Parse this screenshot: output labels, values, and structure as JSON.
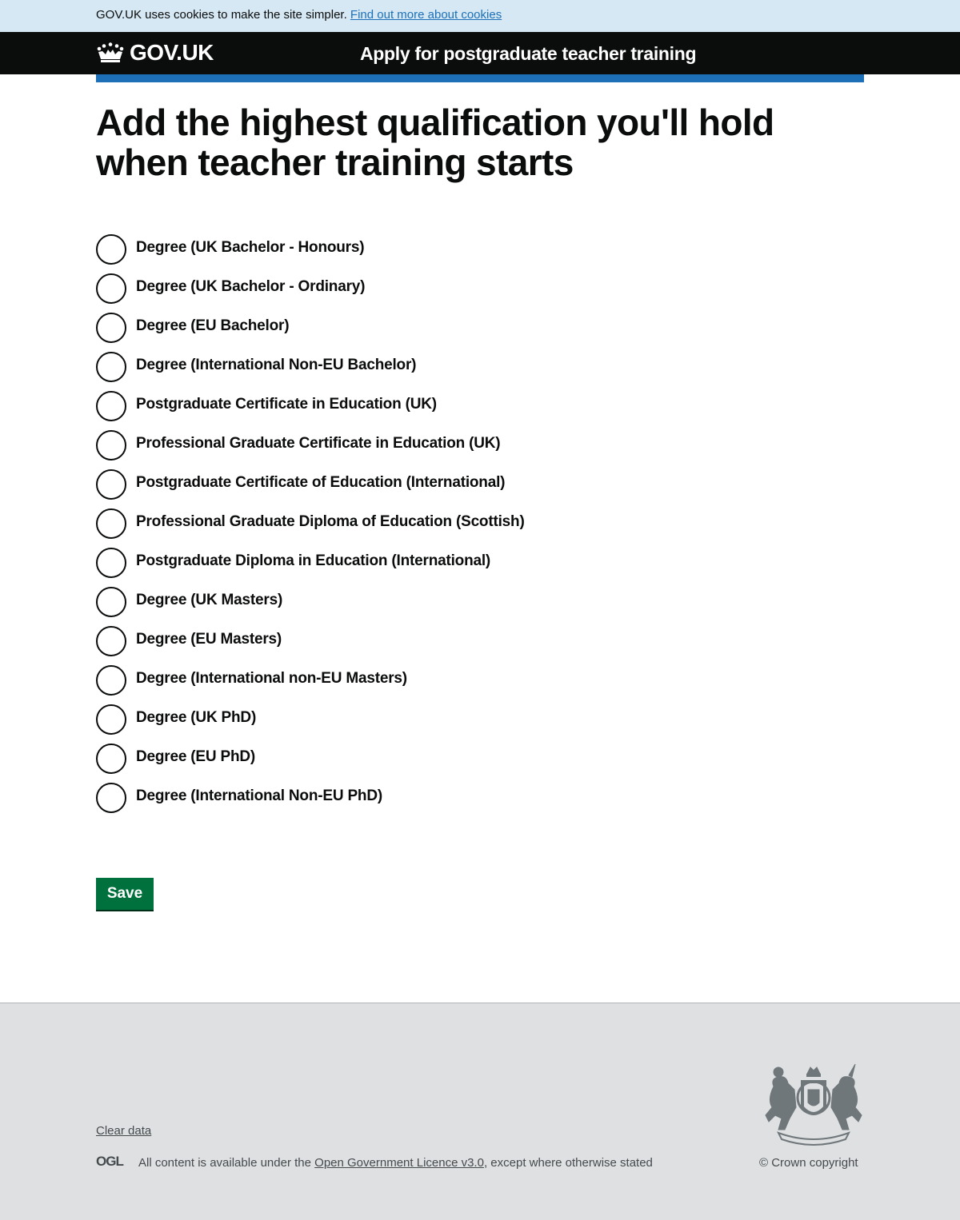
{
  "cookie_banner": {
    "text": "GOV.UK uses cookies to make the site simpler.",
    "link_label": "Find out more about cookies"
  },
  "header": {
    "logo_text": "GOV.UK",
    "service_name": "Apply for postgraduate teacher training"
  },
  "page": {
    "title": "Add the highest qualification you'll hold when teacher training starts"
  },
  "qualifications": [
    {
      "label": "Degree (UK Bachelor - Honours)",
      "selected": false
    },
    {
      "label": "Degree (UK Bachelor - Ordinary)",
      "selected": false
    },
    {
      "label": "Degree (EU Bachelor)",
      "selected": false
    },
    {
      "label": "Degree (International Non-EU Bachelor)",
      "selected": false
    },
    {
      "label": "Postgraduate Certificate in Education (UK)",
      "selected": false
    },
    {
      "label": "Professional Graduate Certificate in Education (UK)",
      "selected": false
    },
    {
      "label": "Postgraduate Certificate of Education (International)",
      "selected": false
    },
    {
      "label": "Professional Graduate Diploma of Education (Scottish)",
      "selected": false
    },
    {
      "label": "Postgraduate Diploma in Education (International)",
      "selected": false
    },
    {
      "label": "Degree (UK Masters)",
      "selected": false
    },
    {
      "label": "Degree (EU Masters)",
      "selected": false
    },
    {
      "label": "Degree (International non-EU Masters)",
      "selected": false
    },
    {
      "label": "Degree (UK PhD)",
      "selected": false
    },
    {
      "label": "Degree (EU PhD)",
      "selected": false
    },
    {
      "label": "Degree (International Non-EU PhD)",
      "selected": false
    }
  ],
  "actions": {
    "save_label": "Save"
  },
  "footer": {
    "clear_data_label": "Clear data",
    "ogl_logo_text": "OGL",
    "licence_prefix": "All content is available under the",
    "licence_link_label": "Open Government Licence v3.0",
    "licence_suffix": ", except where otherwise stated",
    "copyright": "© Crown copyright",
    "crest_motto_left": "DIEU",
    "crest_motto_center": "ET MON",
    "crest_motto_right": "DROIT"
  },
  "colors": {
    "cookie_bg": "#d5e8f3",
    "header_bg": "#0b0c0c",
    "brand_blue": "#1d70b8",
    "button_green": "#00703c",
    "footer_bg": "#dee0e2",
    "text": "#0b0c0c"
  },
  "icons": {
    "logo": "crown-icon",
    "ogl": "ogl-logo-icon",
    "crest": "royal-coat-of-arms-icon"
  }
}
